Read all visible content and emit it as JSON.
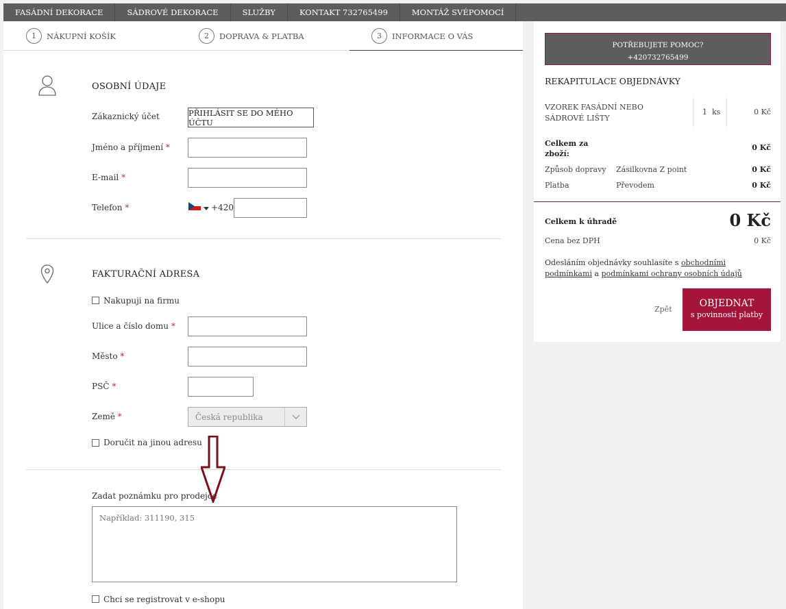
{
  "nav": {
    "items": [
      "FASÁDNÍ DEKORACE",
      "SÁDROVÉ DEKORACE",
      "SLUŽBY",
      "KONTAKT 732765499",
      "MONTÁŽ SVÉPOMOCÍ"
    ]
  },
  "steps": [
    {
      "num": "1",
      "label": "NÁKUPNÍ KOŠÍK"
    },
    {
      "num": "2",
      "label": "DOPRAVA & PLATBA"
    },
    {
      "num": "3",
      "label": "INFORMACE O VÁS"
    }
  ],
  "personal": {
    "title": "OSOBNÍ ÚDAJE",
    "account_label": "Zákaznický účet",
    "login_button": "PŘIHLÁSIT SE DO MÉHO ÚČTU",
    "name_label": "Jméno a příjmení",
    "email_label": "E-mail",
    "phone_label": "Telefon",
    "phone_prefix": "+420",
    "required_mark": "*"
  },
  "billing": {
    "title": "FAKTURAČNÍ ADRESA",
    "company_checkbox": "Nakupuji na firmu",
    "street_label": "Ulice a číslo domu",
    "city_label": "Město",
    "zip_label": "PSČ",
    "country_label": "Země",
    "country_value": "Česká republika",
    "other_address_checkbox": "Doručit na jinou adresu"
  },
  "note": {
    "label": "Zadat poznámku pro prodejce",
    "placeholder": "Například: 311190, 315",
    "register_checkbox": "Chci se registrovat v e-shopu"
  },
  "sidebar": {
    "help_title": "POTŘEBUJETE POMOC?",
    "help_phone": "+420732765499",
    "recap_title": "REKAPITULACE OBJEDNÁVKY",
    "item_name": "VZOREK FASÁDNÍ NEBO SÁDROVÉ LIŠTY",
    "item_qty": "1",
    "item_unit": "ks",
    "item_price": "0 Kč",
    "goods_total_label": "Celkem za zboží:",
    "goods_total_value": "0 Kč",
    "shipping_label": "Způsob dopravy",
    "shipping_value": "Zásilkovna Z point",
    "shipping_price": "0 Kč",
    "payment_label": "Platba",
    "payment_value": "Převodem",
    "payment_price": "0 Kč",
    "total_label": "Celkem k úhradě",
    "total_value": "0 Kč",
    "no_vat_label": "Cena bez DPH",
    "no_vat_value": "0 Kč",
    "terms_prefix": "Odesláním objednávky souhlasíte s",
    "terms_link1": "obchodními podmínkami",
    "terms_and": "a",
    "terms_link2": "podmínkami ochrany osobních údajů",
    "back_label": "Zpět",
    "order_button": "OBJEDNAT",
    "order_button_sub": "s povinností platby"
  },
  "colors": {
    "nav_bg": "#5d5c5e",
    "accent": "#a3143a",
    "arrow": "#7a0f1e"
  }
}
